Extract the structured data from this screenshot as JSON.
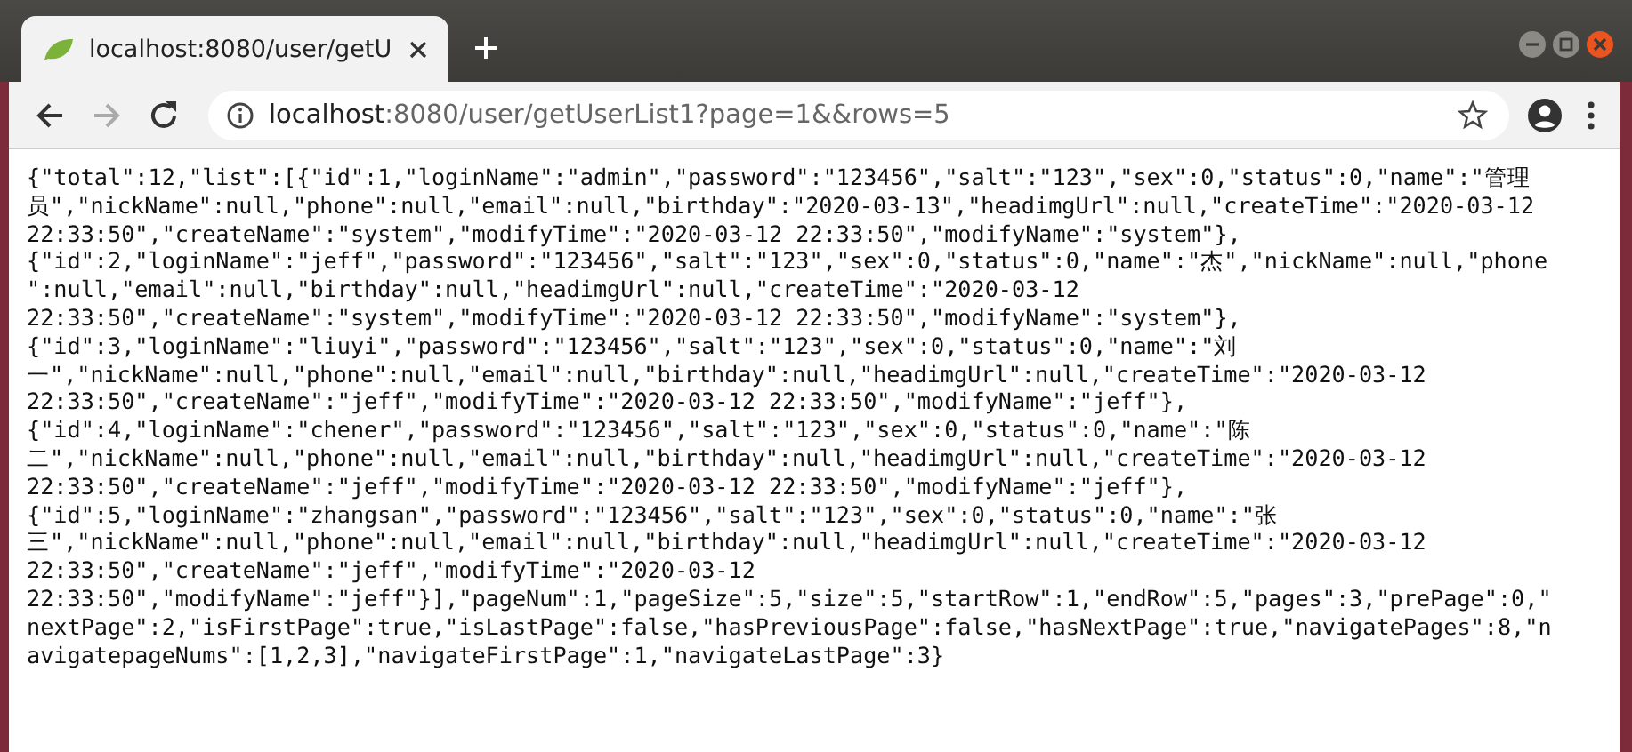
{
  "tab": {
    "title": "localhost:8080/user/getU",
    "selected": true
  },
  "nav": [
    {
      "kind": "back",
      "disabled": false
    },
    {
      "kind": "forward",
      "disabled": true
    },
    {
      "kind": "reload",
      "disabled": false
    }
  ],
  "address": {
    "host": "localhost",
    "rest": ":8080/user/getUserList1?page=1&&rows=5"
  },
  "body_lines": [
    "{\"total\":12,\"list\":[{\"id\":1,\"loginName\":\"admin\",\"password\":\"123456\",\"salt\":\"123\",\"sex\":0,\"status\":0,\"name\":\"管理",
    "员\",\"nickName\":null,\"phone\":null,\"email\":null,\"birthday\":\"2020-03-13\",\"headimgUrl\":null,\"createTime\":\"2020-03-12",
    "22:33:50\",\"createName\":\"system\",\"modifyTime\":\"2020-03-12 22:33:50\",\"modifyName\":\"system\"},",
    "{\"id\":2,\"loginName\":\"jeff\",\"password\":\"123456\",\"salt\":\"123\",\"sex\":0,\"status\":0,\"name\":\"杰\",\"nickName\":null,\"phone",
    "\":null,\"email\":null,\"birthday\":null,\"headimgUrl\":null,\"createTime\":\"2020-03-12",
    "22:33:50\",\"createName\":\"system\",\"modifyTime\":\"2020-03-12 22:33:50\",\"modifyName\":\"system\"},",
    "{\"id\":3,\"loginName\":\"liuyi\",\"password\":\"123456\",\"salt\":\"123\",\"sex\":0,\"status\":0,\"name\":\"刘",
    "一\",\"nickName\":null,\"phone\":null,\"email\":null,\"birthday\":null,\"headimgUrl\":null,\"createTime\":\"2020-03-12",
    "22:33:50\",\"createName\":\"jeff\",\"modifyTime\":\"2020-03-12 22:33:50\",\"modifyName\":\"jeff\"},",
    "{\"id\":4,\"loginName\":\"chener\",\"password\":\"123456\",\"salt\":\"123\",\"sex\":0,\"status\":0,\"name\":\"陈",
    "二\",\"nickName\":null,\"phone\":null,\"email\":null,\"birthday\":null,\"headimgUrl\":null,\"createTime\":\"2020-03-12",
    "22:33:50\",\"createName\":\"jeff\",\"modifyTime\":\"2020-03-12 22:33:50\",\"modifyName\":\"jeff\"},",
    "{\"id\":5,\"loginName\":\"zhangsan\",\"password\":\"123456\",\"salt\":\"123\",\"sex\":0,\"status\":0,\"name\":\"张",
    "三\",\"nickName\":null,\"phone\":null,\"email\":null,\"birthday\":null,\"headimgUrl\":null,\"createTime\":\"2020-03-12",
    "22:33:50\",\"createName\":\"jeff\",\"modifyTime\":\"2020-03-12",
    "22:33:50\",\"modifyName\":\"jeff\"}],\"pageNum\":1,\"pageSize\":5,\"size\":5,\"startRow\":1,\"endRow\":5,\"pages\":3,\"prePage\":0,\"",
    "nextPage\":2,\"isFirstPage\":true,\"isLastPage\":false,\"hasPreviousPage\":false,\"hasNextPage\":true,\"navigatePages\":8,\"n",
    "avigatepageNums\":[1,2,3],\"navigateFirstPage\":1,\"navigateLastPage\":3}"
  ]
}
